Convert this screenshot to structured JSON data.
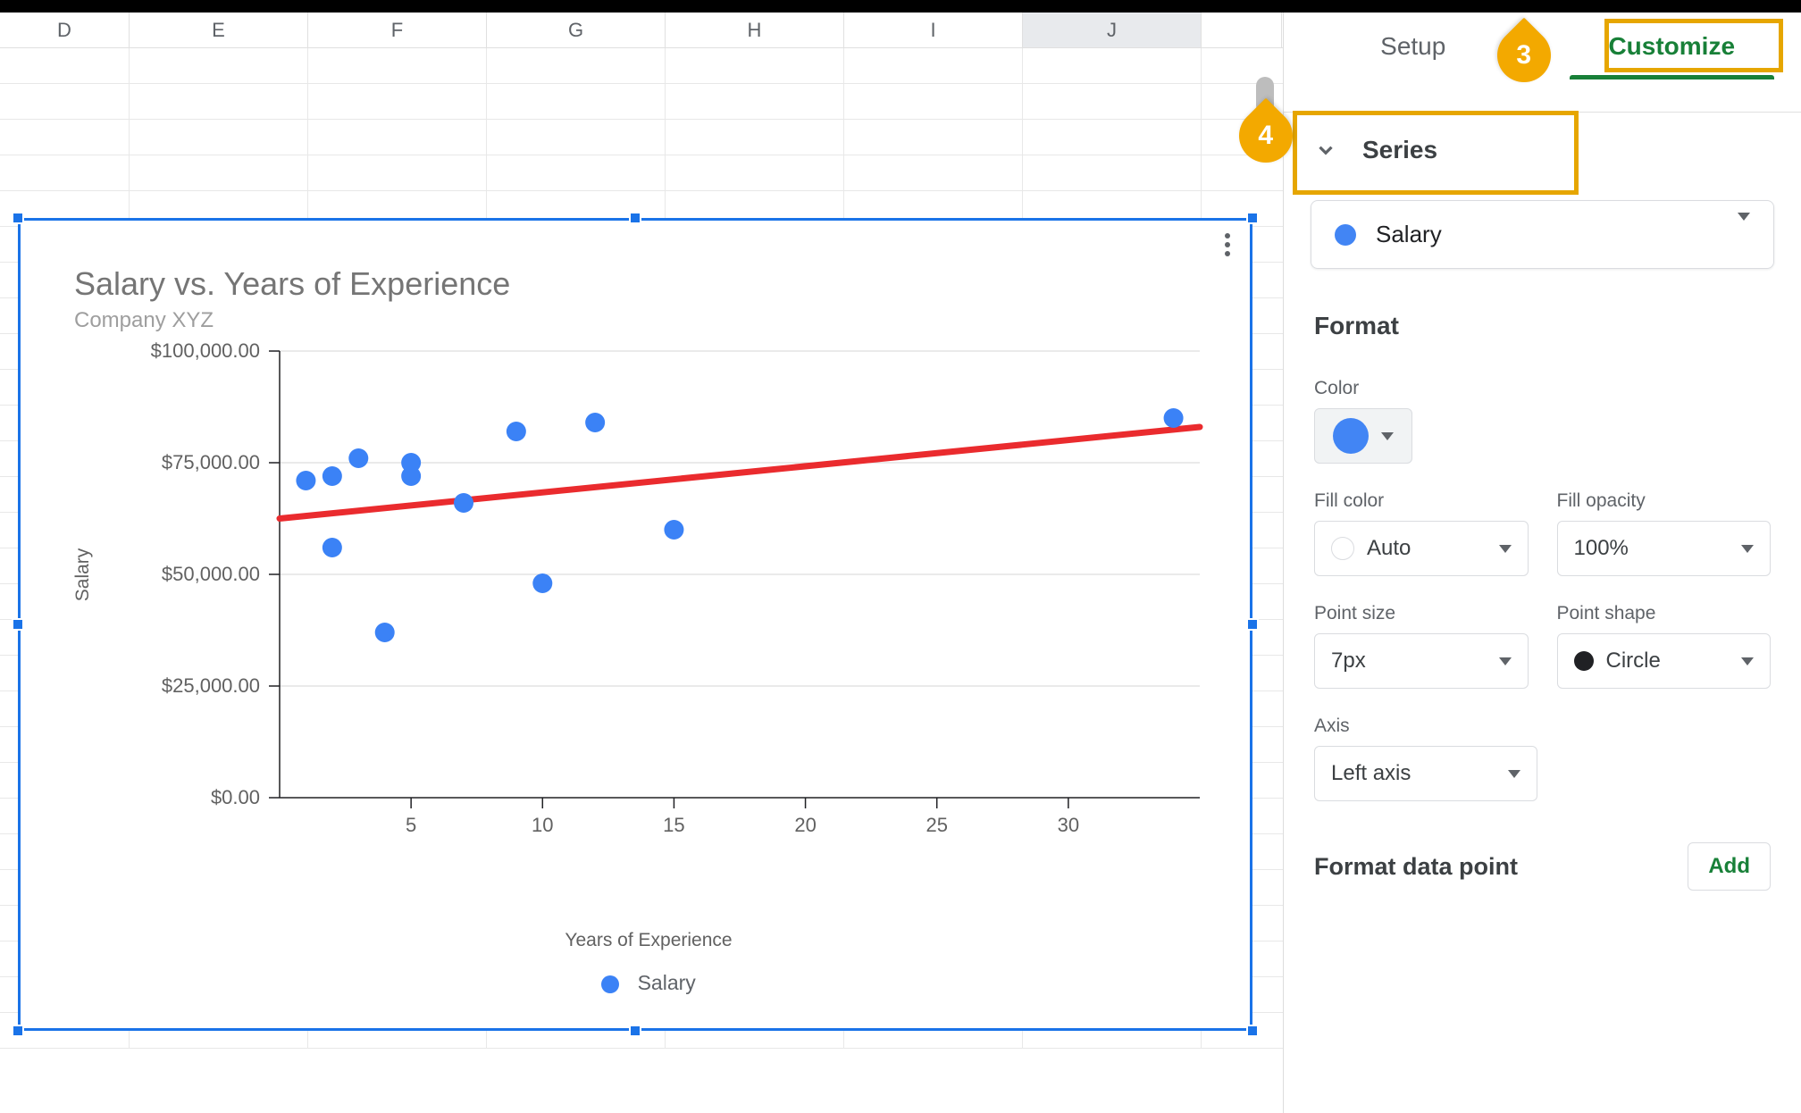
{
  "columns": [
    "D",
    "E",
    "F",
    "G",
    "H",
    "I",
    "J"
  ],
  "tabs": {
    "setup": "Setup",
    "customize": "Customize"
  },
  "annotations": {
    "three": "3",
    "four": "4"
  },
  "section": {
    "series": "Series"
  },
  "series_select": {
    "value": "Salary"
  },
  "format_heading": "Format",
  "labels": {
    "color": "Color",
    "fill_color": "Fill color",
    "fill_opacity": "Fill opacity",
    "point_size": "Point size",
    "point_shape": "Point shape",
    "axis": "Axis",
    "format_data_point": "Format data point",
    "add": "Add"
  },
  "values": {
    "fill_color": "Auto",
    "fill_opacity": "100%",
    "point_size": "7px",
    "point_shape": "Circle",
    "axis": "Left axis",
    "series_color": "#4285f4"
  },
  "chart": {
    "title": "Salary vs. Years of Experience",
    "subtitle": "Company XYZ",
    "xlabel": "Years of Experience",
    "ylabel": "Salary",
    "legend": "Salary"
  },
  "chart_data": {
    "type": "scatter",
    "title": "Salary vs. Years of Experience",
    "subtitle": "Company XYZ",
    "xlabel": "Years of Experience",
    "ylabel": "Salary",
    "x_ticks": [
      5,
      10,
      15,
      20,
      25,
      30
    ],
    "y_ticks": [
      "$0.00",
      "$25,000.00",
      "$50,000.00",
      "$75,000.00",
      "$100,000.00"
    ],
    "xlim": [
      0,
      35
    ],
    "ylim": [
      0,
      100000
    ],
    "series": [
      {
        "name": "Salary",
        "x": [
          1,
          2,
          2,
          3,
          4,
          5,
          5,
          7,
          9,
          10,
          12,
          15,
          34
        ],
        "y": [
          71000,
          72000,
          56000,
          76000,
          37000,
          72000,
          75000,
          66000,
          82000,
          48000,
          84000,
          60000,
          85000
        ]
      }
    ],
    "trend": {
      "type": "linear",
      "x1": 0,
      "y1": 62500,
      "x2": 35,
      "y2": 83000,
      "color": "#ea2b2e"
    },
    "colors": {
      "point": "#3b82f6",
      "trend": "#ea2b2e"
    }
  }
}
